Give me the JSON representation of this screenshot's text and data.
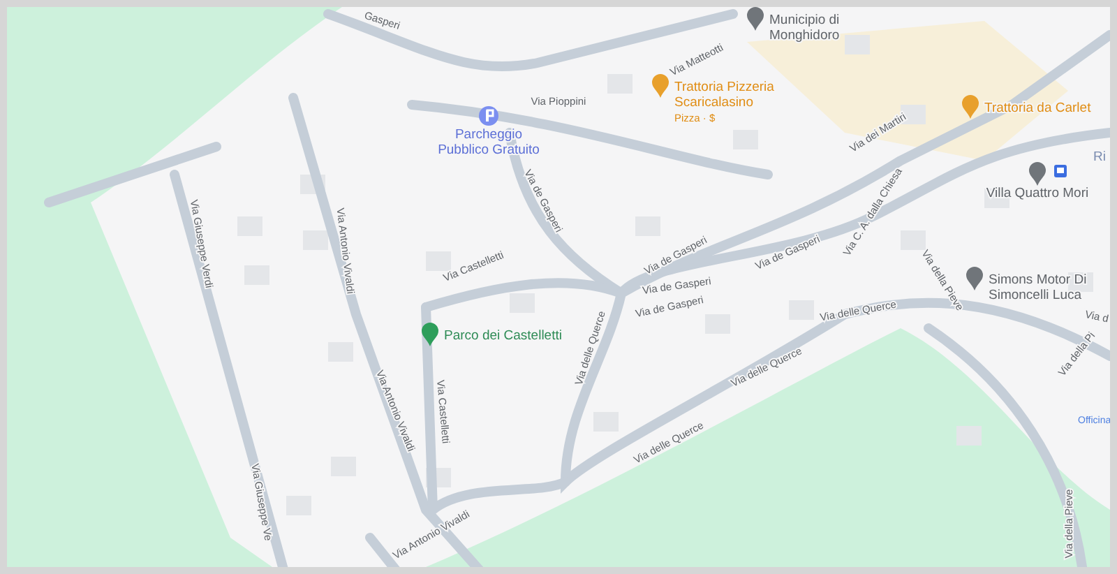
{
  "map": {
    "places": [
      {
        "kind": "parking",
        "lines": [
          "Parcheggio",
          "Pubblico Gratuito"
        ]
      },
      {
        "kind": "civic",
        "lines": [
          "Municipio di",
          "Monghidoro"
        ]
      },
      {
        "kind": "food",
        "lines": [
          "Trattoria Pizzeria",
          "Scaricalasino"
        ],
        "detail": "Pizza · $"
      },
      {
        "kind": "food",
        "lines": [
          "Trattoria da Carlet"
        ]
      },
      {
        "kind": "civic",
        "lines": [
          "Villa Quattro Mori"
        ],
        "bus": true
      },
      {
        "kind": "civic",
        "lines": [
          "Simons Motor Di",
          "Simoncelli Luca"
        ]
      },
      {
        "kind": "park",
        "lines": [
          "Parco dei Castelletti"
        ]
      },
      {
        "kind": "cut",
        "lines": [
          "Ri"
        ]
      },
      {
        "kind": "service",
        "lines": [
          "Officina"
        ]
      }
    ],
    "streets": [
      {
        "name": "Gasperi"
      },
      {
        "name": "Via Pioppini"
      },
      {
        "name": "Via Matteotti"
      },
      {
        "name": "Via dei Martiri"
      },
      {
        "name": "Via C. A. dalla Chiesa"
      },
      {
        "name": "Via de Gasperi"
      },
      {
        "name": "Via Castelletti"
      },
      {
        "name": "Via de Gasperi"
      },
      {
        "name": "Via de Gasperi"
      },
      {
        "name": "Via de Gasperi"
      },
      {
        "name": "Via de Gasperi"
      },
      {
        "name": "Via delle Querce"
      },
      {
        "name": "Via delle Querce"
      },
      {
        "name": "Via delle Querce"
      },
      {
        "name": "Via delle Querce"
      },
      {
        "name": "Via della Pieve"
      },
      {
        "name": "Via della Pieve"
      },
      {
        "name": "Via della Pi"
      },
      {
        "name": "Via d"
      },
      {
        "name": "Via Giuseppe Verdi"
      },
      {
        "name": "Via Giuseppe Ve"
      },
      {
        "name": "Via Antonio Vivaldi"
      },
      {
        "name": "Via Antonio Vivaldi"
      },
      {
        "name": "Via Antonio Vivaldi"
      },
      {
        "name": "Via Castelletti"
      }
    ]
  }
}
